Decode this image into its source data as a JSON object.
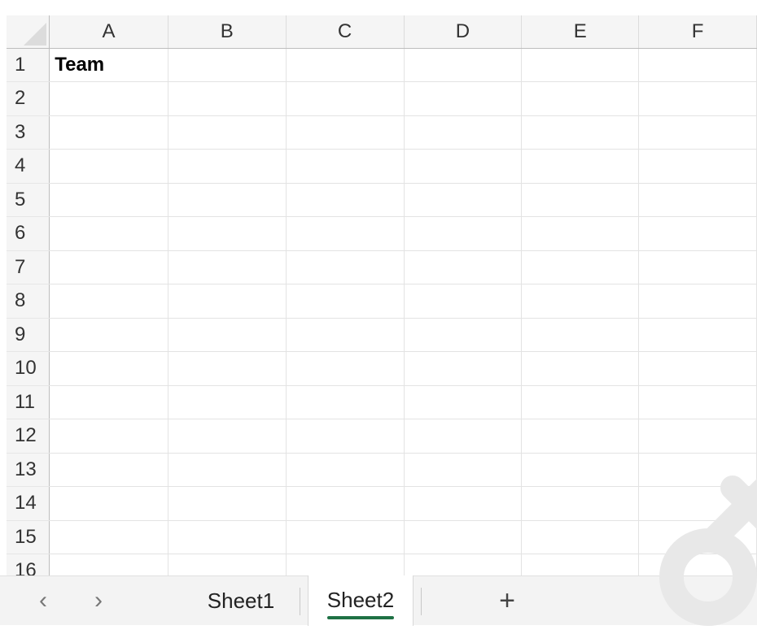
{
  "columns": [
    "A",
    "B",
    "C",
    "D",
    "E",
    "F"
  ],
  "rows": [
    "1",
    "2",
    "3",
    "4",
    "5",
    "6",
    "7",
    "8",
    "9",
    "10",
    "11",
    "12",
    "13",
    "14",
    "15",
    "16"
  ],
  "cells": {
    "A1": "Team"
  },
  "tabs": {
    "prev_icon": "‹",
    "next_icon": "›",
    "sheets": [
      "Sheet1",
      "Sheet2"
    ],
    "active_sheet": "Sheet2",
    "add_label": "+"
  },
  "colors": {
    "active_tab_underline": "#1e7145",
    "header_bg": "#f5f5f5",
    "gridline": "#e3e3e3"
  }
}
